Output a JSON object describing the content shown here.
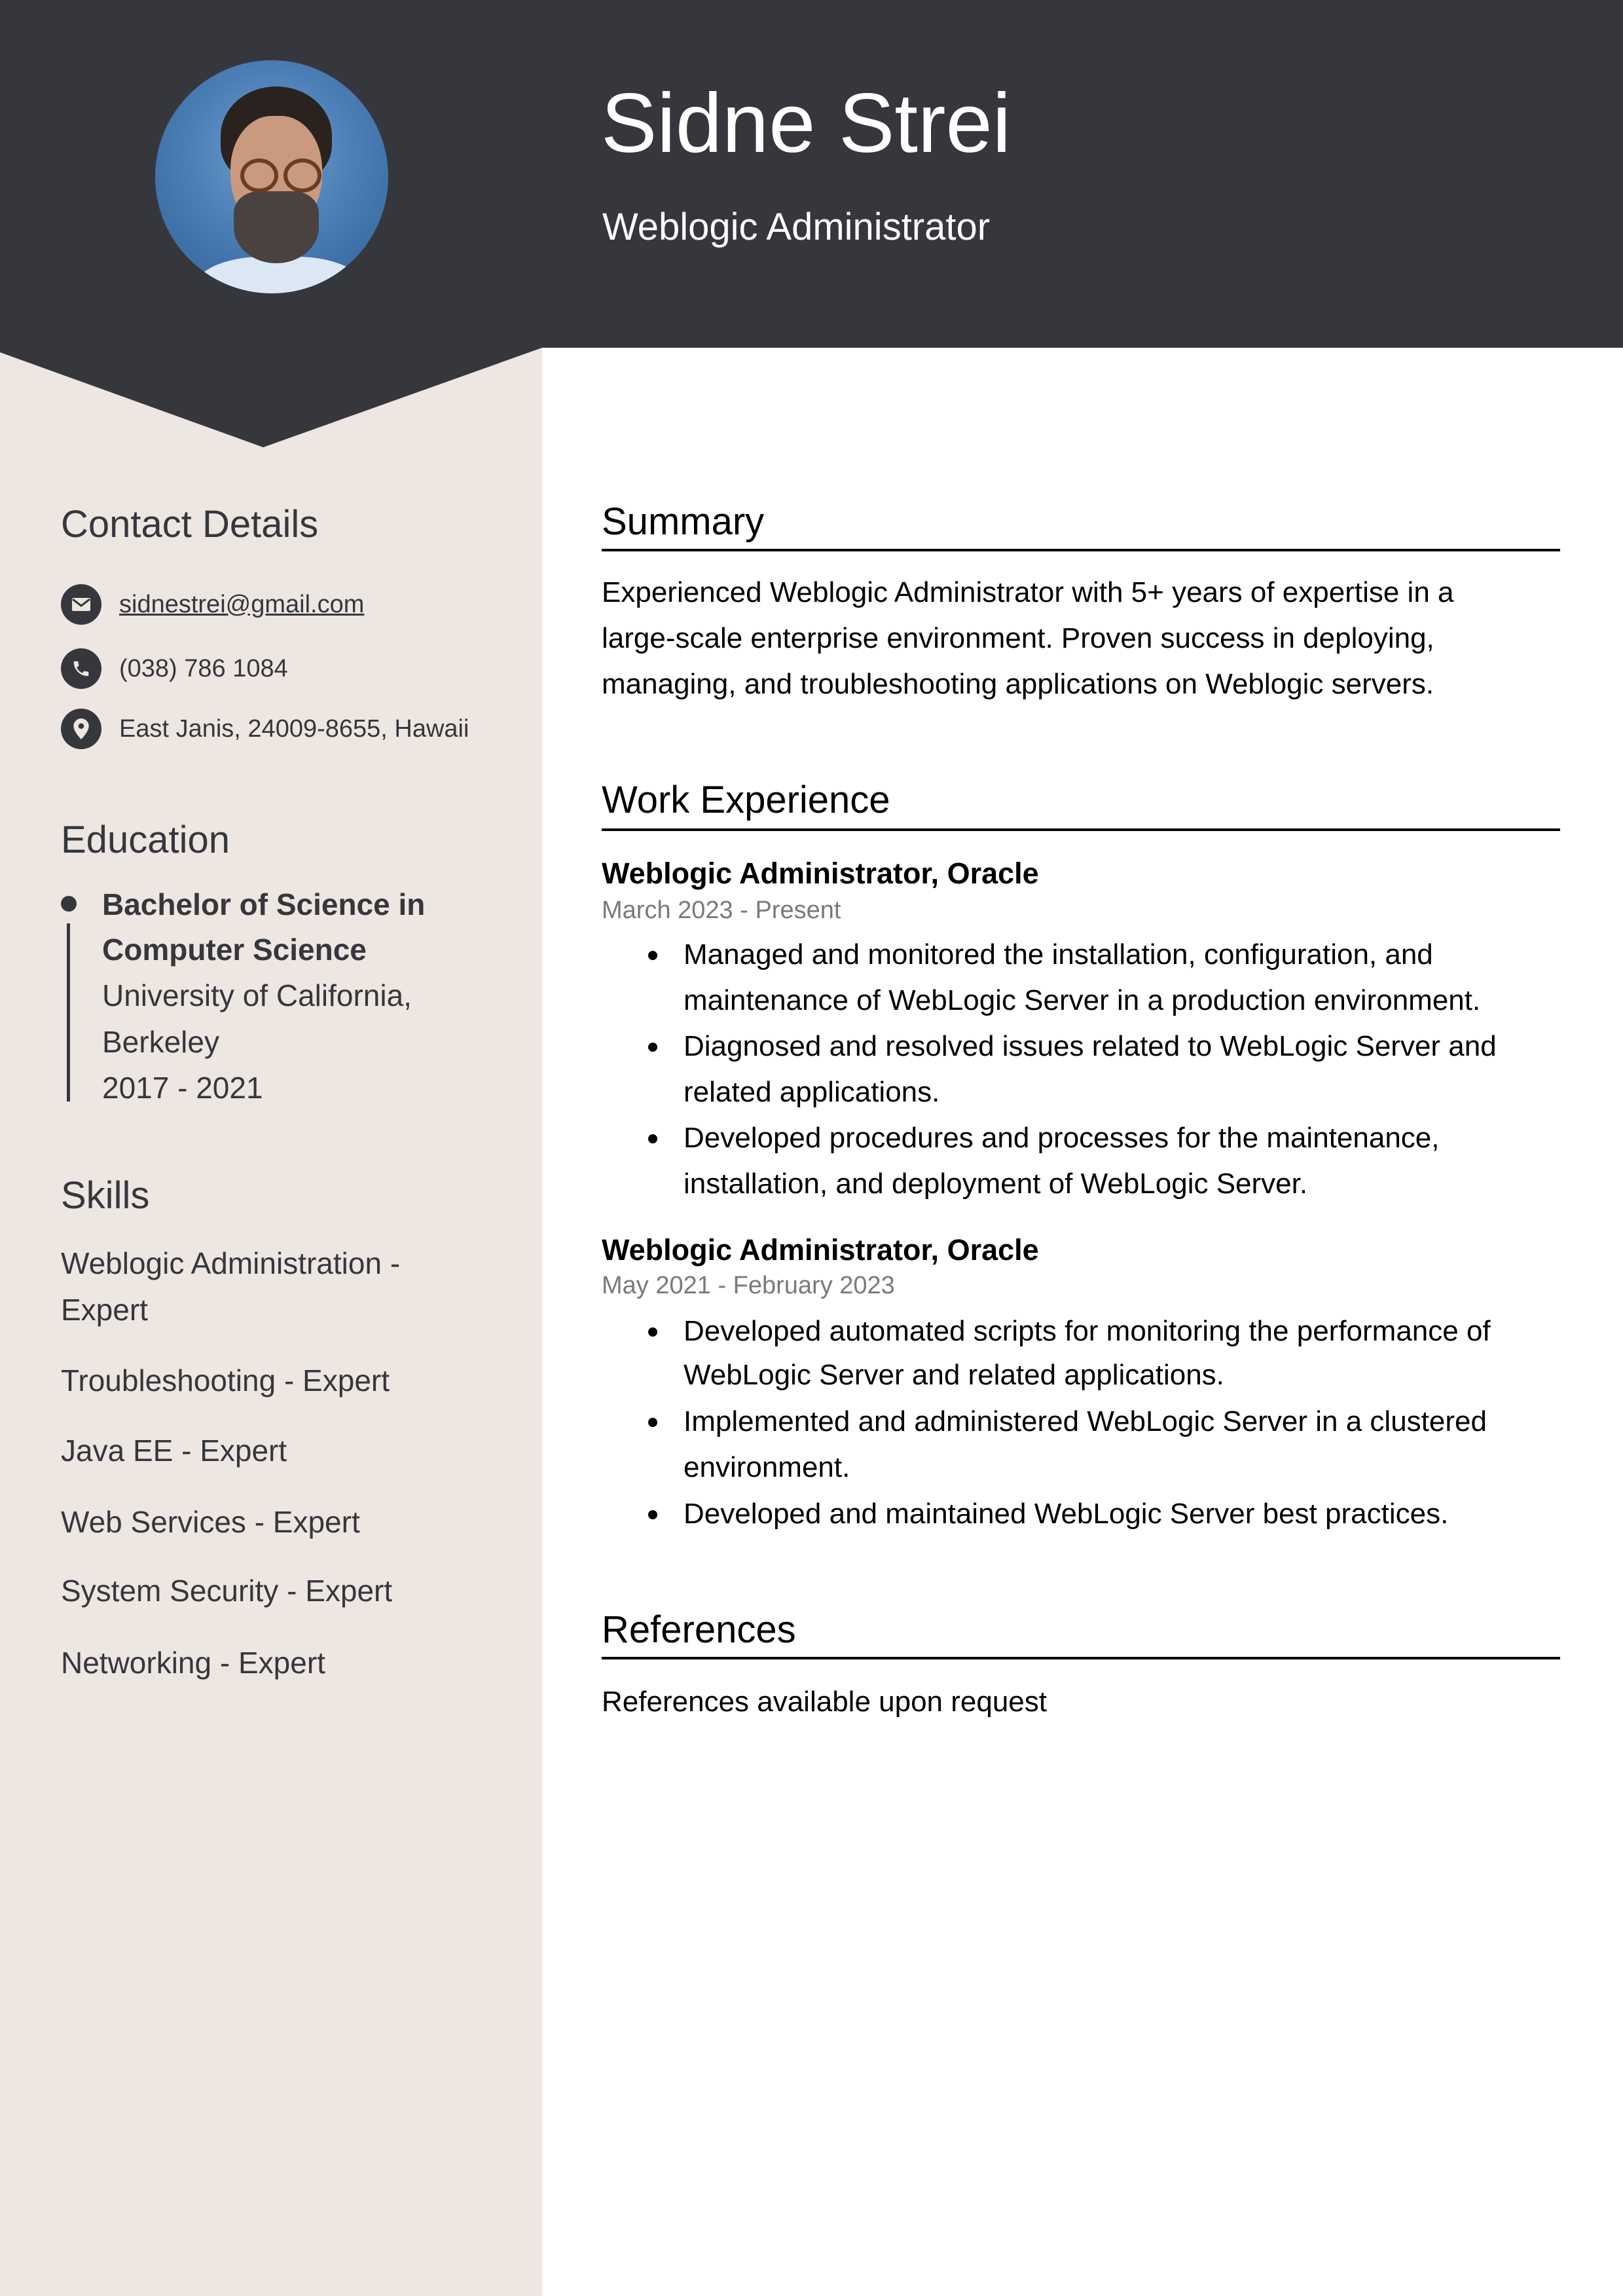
{
  "header": {
    "name": "Sidne Strei",
    "job_title": "Weblogic Administrator",
    "colors": {
      "header_bg": "#36373d",
      "sidebar_bg": "#ede6e1",
      "text_dark": "#36373d"
    }
  },
  "sidebar": {
    "contact": {
      "heading": "Contact Details",
      "email": {
        "icon": "envelope-icon",
        "value": "sidnestrei@gmail.com"
      },
      "phone": {
        "icon": "phone-icon",
        "value": "(038) 786 1084"
      },
      "address": {
        "icon": "map-pin-icon",
        "value": "East Janis, 24009-8655, Hawaii"
      }
    },
    "education": {
      "heading": "Education",
      "degree_lines": [
        "Bachelor of Science in",
        "Computer Science"
      ],
      "school_lines": [
        "University of California,",
        "Berkeley"
      ],
      "years": "2017 - 2021"
    },
    "skills": {
      "heading": "Skills",
      "items": [
        [
          "Weblogic Administration -",
          "Expert"
        ],
        [
          "Troubleshooting - Expert"
        ],
        [
          "Java EE - Expert"
        ],
        [
          "Web Services - Expert"
        ],
        [
          "System Security - Expert"
        ],
        [
          "Networking - Expert"
        ]
      ]
    }
  },
  "main": {
    "summary": {
      "heading": "Summary",
      "lines": [
        "Experienced Weblogic Administrator with 5+ years of expertise in a",
        "large-scale enterprise environment. Proven success in deploying,",
        "managing, and troubleshooting applications on Weblogic servers."
      ]
    },
    "work": {
      "heading": "Work Experience",
      "jobs": [
        {
          "title": "Weblogic Administrator, Oracle",
          "dates": "March 2023 - Present",
          "bullets": [
            [
              "Managed and monitored the installation, configuration, and",
              "maintenance of WebLogic Server in a production environment."
            ],
            [
              "Diagnosed and resolved issues related to WebLogic Server and",
              "related applications."
            ],
            [
              "Developed procedures and processes for the maintenance,",
              "installation, and deployment of WebLogic Server."
            ]
          ]
        },
        {
          "title": "Weblogic Administrator, Oracle",
          "dates": "May 2021 - February 2023",
          "bullets": [
            [
              "Developed automated scripts for monitoring the performance of",
              "WebLogic Server and related applications."
            ],
            [
              "Implemented and administered WebLogic Server in a clustered",
              "environment."
            ],
            [
              "Developed and maintained WebLogic Server best practices."
            ]
          ]
        }
      ]
    },
    "references": {
      "heading": "References",
      "text": "References available upon request"
    }
  }
}
